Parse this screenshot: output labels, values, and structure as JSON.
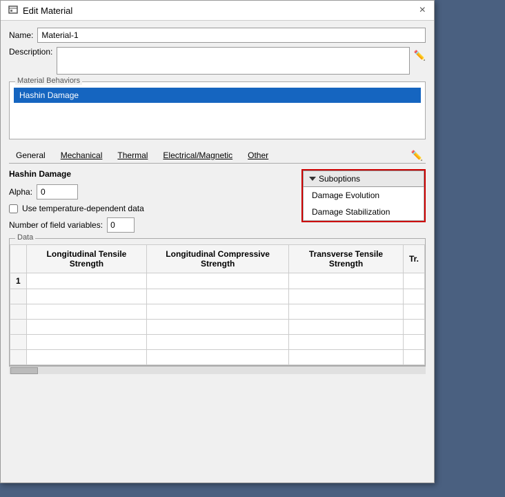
{
  "dialog": {
    "title": "Edit Material",
    "close_label": "×"
  },
  "name_field": {
    "label": "Name:",
    "value": "Material-1"
  },
  "description_field": {
    "label": "Description:",
    "placeholder": ""
  },
  "material_behaviors": {
    "section_label": "Material Behaviors",
    "items": [
      {
        "label": "Hashin Damage",
        "selected": true
      }
    ]
  },
  "tabs": {
    "items": [
      {
        "label": "General",
        "underline": false
      },
      {
        "label": "Mechanical",
        "underline": true
      },
      {
        "label": "Thermal",
        "underline": true
      },
      {
        "label": "Electrical/Magnetic",
        "underline": true
      },
      {
        "label": "Other",
        "underline": true
      }
    ]
  },
  "hashin_section": {
    "title": "Hashin Damage",
    "alpha_label": "Alpha:",
    "alpha_value": "0",
    "temp_checkbox_label": "Use temperature-dependent data",
    "field_vars_label": "Number of field variables:",
    "field_vars_value": "0"
  },
  "suboptions": {
    "header": "Suboptions",
    "items": [
      {
        "label": "Damage Evolution"
      },
      {
        "label": "Damage Stabilization"
      }
    ]
  },
  "data_section": {
    "label": "Data",
    "columns": [
      "Longitudinal Tensile Strength",
      "Longitudinal Compressive Strength",
      "Transverse Tensile Strength",
      "Tr."
    ],
    "rows": [
      {
        "num": "1",
        "cells": [
          "",
          "",
          "",
          ""
        ]
      }
    ]
  }
}
